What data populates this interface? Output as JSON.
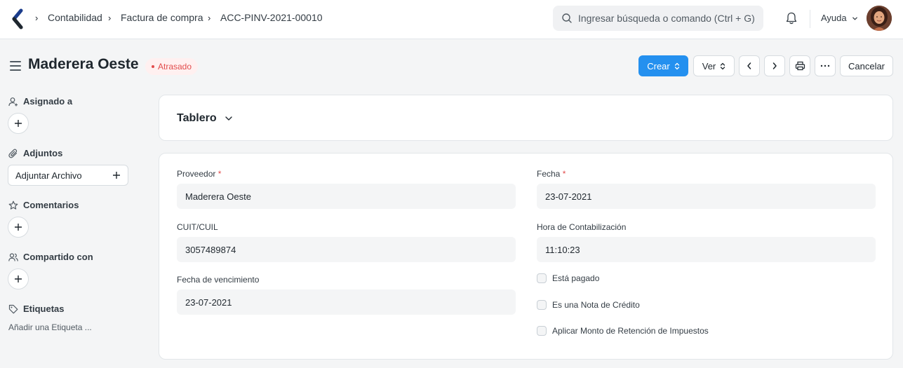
{
  "breadcrumbs": [
    "Contabilidad",
    "Factura de compra",
    "ACC-PINV-2021-00010"
  ],
  "search": {
    "placeholder": "Ingresar búsqueda o comando (Ctrl + G)"
  },
  "navbar": {
    "help_label": "Ayuda"
  },
  "page": {
    "title": "Maderera Oeste",
    "status": "Atrasado"
  },
  "actions": {
    "create_label": "Crear",
    "view_label": "Ver",
    "cancel_label": "Cancelar"
  },
  "sidebar": {
    "assigned_label": "Asignado a",
    "attachments_label": "Adjuntos",
    "attach_button_label": "Adjuntar Archivo",
    "comments_label": "Comentarios",
    "shared_label": "Compartido con",
    "tags_label": "Etiquetas",
    "add_tag_label": "Añadir una Etiqueta ..."
  },
  "dashboard": {
    "title": "Tablero"
  },
  "form": {
    "supplier": {
      "label": "Proveedor",
      "value": "Maderera Oeste",
      "required": "*"
    },
    "tax_id": {
      "label": "CUIT/CUIL",
      "value": "3057489874"
    },
    "due_date": {
      "label": "Fecha de vencimiento",
      "value": "23-07-2021"
    },
    "date": {
      "label": "Fecha",
      "value": "23-07-2021",
      "required": "*"
    },
    "posting_time": {
      "label": "Hora de Contabilización",
      "value": "11:10:23"
    },
    "checks": [
      {
        "label": "Está pagado",
        "checked": false
      },
      {
        "label": "Es una Nota de Crédito",
        "checked": false
      },
      {
        "label": "Aplicar Monto de Retención de Impuestos",
        "checked": false
      }
    ]
  },
  "colors": {
    "primary": "#2490ef",
    "status_red": "#e24c4c",
    "background": "#f4f5f6"
  }
}
